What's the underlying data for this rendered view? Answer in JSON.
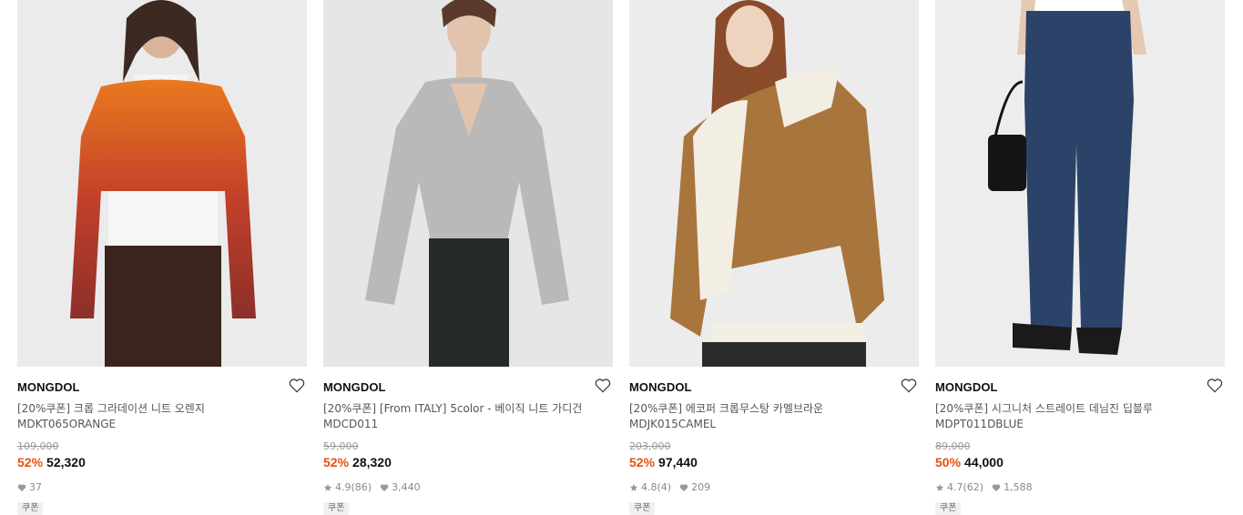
{
  "products": [
    {
      "brand": "MONGDOL",
      "name": "[20%쿠폰] 크롭 그라데이션 니트 오렌지",
      "code": "MDKT065ORANGE",
      "original_price": "109,000",
      "discount_rate": "52%",
      "price": "52,320",
      "rating": "",
      "review_count": "",
      "like_count": "37",
      "coupon_tag": "쿠폰",
      "colors": {
        "bg": "#ebebeb",
        "top": "#c95a25",
        "bottom": "#3a2a22"
      }
    },
    {
      "brand": "MONGDOL",
      "name": "[20%쿠폰] [From ITALY] 5color - 베이직 니트 가디건",
      "code": "MDCD011",
      "original_price": "59,000",
      "discount_rate": "52%",
      "price": "28,320",
      "rating": "4.9",
      "review_count": "(86)",
      "like_count": "3,440",
      "coupon_tag": "쿠폰",
      "colors": {
        "bg": "#e6e6e6",
        "top": "#b9b9b9",
        "bottom": "#2a2d2a"
      }
    },
    {
      "brand": "MONGDOL",
      "name": "[20%쿠폰] 에코퍼 크롭무스탕 카멜브라운",
      "code": "MDJK015CAMEL",
      "original_price": "203,000",
      "discount_rate": "52%",
      "price": "97,440",
      "rating": "4.8",
      "review_count": "(4)",
      "like_count": "209",
      "coupon_tag": "쿠폰",
      "colors": {
        "bg": "#ececec",
        "top": "#a8753c",
        "bottom": "#2b2b2b"
      }
    },
    {
      "brand": "MONGDOL",
      "name": "[20%쿠폰] 시그니처 스트레이트 데님진 딥블루",
      "code": "MDPT011DBLUE",
      "original_price": "89,000",
      "discount_rate": "50%",
      "price": "44,000",
      "rating": "4.7",
      "review_count": "(62)",
      "like_count": "1,588",
      "coupon_tag": "쿠폰",
      "colors": {
        "bg": "#ededed",
        "top": "#ffffff",
        "bottom": "#2c4369"
      }
    }
  ],
  "icons": {
    "wishlist": "heart-outline-icon",
    "rating": "star-icon",
    "likes": "heart-filled-icon"
  }
}
